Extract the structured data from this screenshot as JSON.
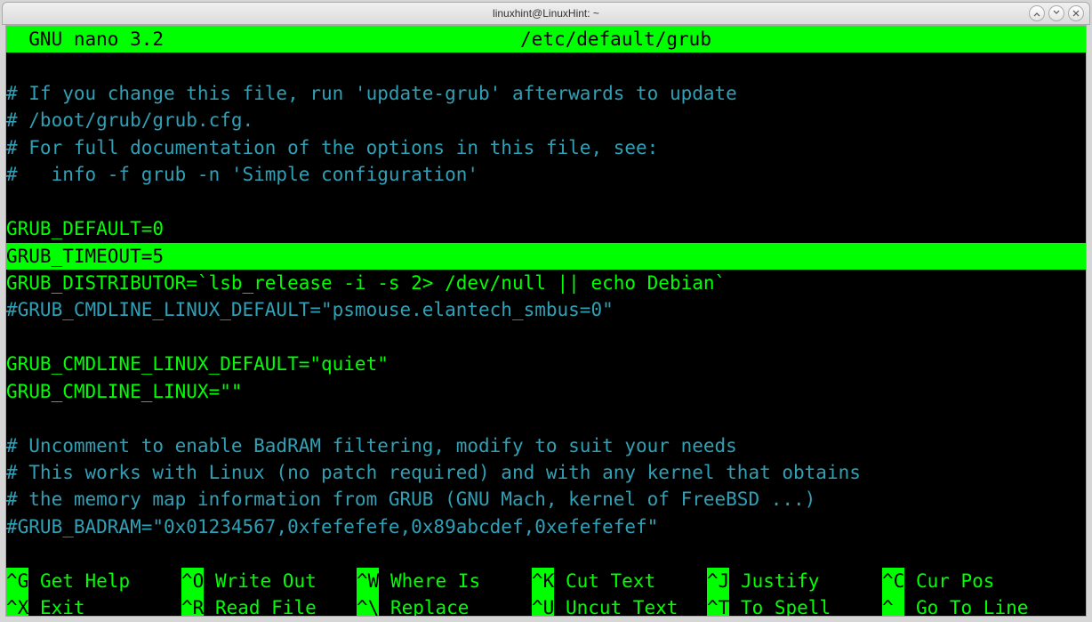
{
  "window": {
    "title": "linuxhint@LinuxHint: ~"
  },
  "nano": {
    "app_version": "  GNU nano 3.2",
    "filename": "/etc/default/grub"
  },
  "lines": [
    {
      "cls": "blank",
      "text": ""
    },
    {
      "cls": "comment",
      "text": "# If you change this file, run 'update-grub' afterwards to update"
    },
    {
      "cls": "comment",
      "text": "# /boot/grub/grub.cfg."
    },
    {
      "cls": "comment",
      "text": "# For full documentation of the options in this file, see:"
    },
    {
      "cls": "comment",
      "text": "#   info -f grub -n 'Simple configuration'"
    },
    {
      "cls": "blank",
      "text": ""
    },
    {
      "cls": "assign",
      "text": "GRUB_DEFAULT=0"
    },
    {
      "cls": "cursor-line",
      "text": "GRUB_TIMEOUT=5"
    },
    {
      "cls": "assign",
      "text": "GRUB_DISTRIBUTOR=`lsb_release -i -s 2> /dev/null || echo Debian`"
    },
    {
      "cls": "comment",
      "text": "#GRUB_CMDLINE_LINUX_DEFAULT=\"psmouse.elantech_smbus=0\""
    },
    {
      "cls": "blank",
      "text": ""
    },
    {
      "cls": "assign",
      "text": "GRUB_CMDLINE_LINUX_DEFAULT=\"quiet\""
    },
    {
      "cls": "assign",
      "text": "GRUB_CMDLINE_LINUX=\"\""
    },
    {
      "cls": "blank",
      "text": ""
    },
    {
      "cls": "comment",
      "text": "# Uncomment to enable BadRAM filtering, modify to suit your needs"
    },
    {
      "cls": "comment",
      "text": "# This works with Linux (no patch required) and with any kernel that obtains"
    },
    {
      "cls": "comment",
      "text": "# the memory map information from GRUB (GNU Mach, kernel of FreeBSD ...)"
    },
    {
      "cls": "comment",
      "text": "#GRUB_BADRAM=\"0x01234567,0xfefefefe,0x89abcdef,0xefefefef\""
    },
    {
      "cls": "blank",
      "text": ""
    }
  ],
  "shortcuts_row1": [
    {
      "key": "^G",
      "label": " Get Help"
    },
    {
      "key": "^O",
      "label": " Write Out"
    },
    {
      "key": "^W",
      "label": " Where Is"
    },
    {
      "key": "^K",
      "label": " Cut Text"
    },
    {
      "key": "^J",
      "label": " Justify"
    },
    {
      "key": "^C",
      "label": " Cur Pos"
    }
  ],
  "shortcuts_row2": [
    {
      "key": "^X",
      "label": " Exit"
    },
    {
      "key": "^R",
      "label": " Read File"
    },
    {
      "key": "^\\",
      "label": " Replace"
    },
    {
      "key": "^U",
      "label": " Uncut Text"
    },
    {
      "key": "^T",
      "label": " To Spell"
    },
    {
      "key": "^_",
      "label": " Go To Line"
    }
  ]
}
